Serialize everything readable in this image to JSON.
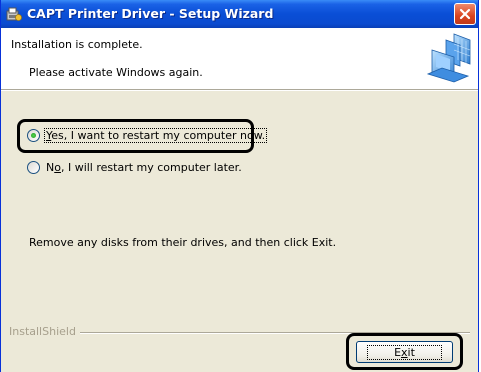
{
  "window": {
    "title": "CAPT Printer Driver - Setup Wizard"
  },
  "header": {
    "title": "Installation is complete.",
    "subtitle": "Please activate Windows again."
  },
  "options": [
    {
      "prefix": "",
      "accel": "Y",
      "rest": "es, I want to restart my computer now.",
      "selected": true
    },
    {
      "prefix": "N",
      "accel": "o",
      "rest": ", I will restart my computer later.",
      "selected": false
    }
  ],
  "instruction": "Remove any disks from their drives, and then click Exit.",
  "brand": "InstallShield",
  "exit_button": {
    "pre": "E",
    "accel": "x",
    "post": "it"
  },
  "colors": {
    "titlebar": "#0a4ed6",
    "dialog_bg": "#ece9d8",
    "close": "#d9431f"
  },
  "icons": [
    "setup-icon",
    "close-icon",
    "computer-art"
  ]
}
